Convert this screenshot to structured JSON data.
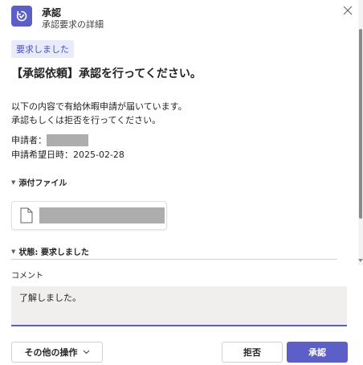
{
  "header": {
    "app_title": "承認",
    "app_subtitle": "承認要求の詳細"
  },
  "status_badge": "要求しました",
  "title": "【承認依頼】承認を行ってください。",
  "message": {
    "line1": "以下の内容で有給休暇申請が届いています。",
    "line2": "承認もしくは拒否を行ってください。"
  },
  "details": {
    "requester_label": "申請者：",
    "date_label": "申請希望日時：2025-02-28"
  },
  "attachments_section": {
    "label": "添付ファイル"
  },
  "status_section": {
    "label": "状態: 要求しました"
  },
  "comment": {
    "label": "コメント",
    "value": "了解しました。"
  },
  "buttons": {
    "more_actions": "その他の操作",
    "reject": "拒否",
    "approve": "承認"
  },
  "colors": {
    "accent": "#5b5fc7",
    "badge_bg": "#e8ebfa",
    "badge_text": "#4f52b2",
    "comment_bg": "#f0efee"
  }
}
